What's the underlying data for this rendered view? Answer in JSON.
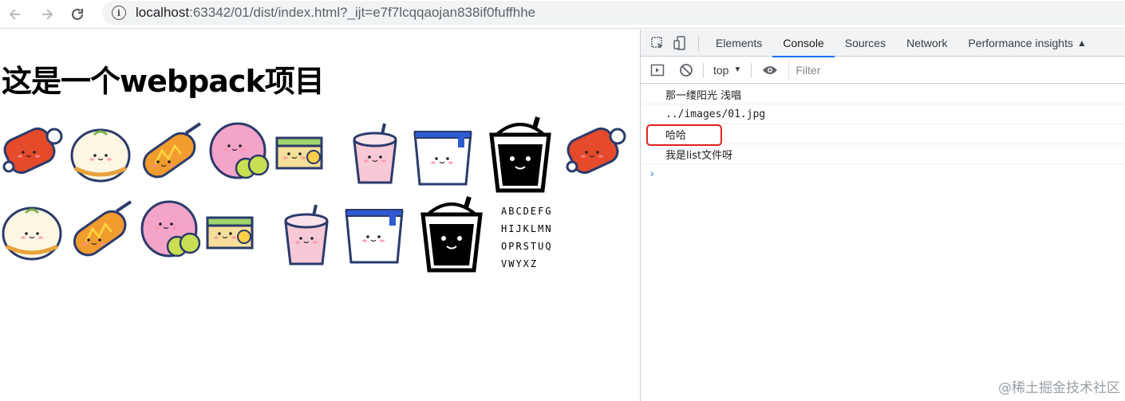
{
  "browser": {
    "url_host": "localhost",
    "url_rest": ":63342/01/dist/index.html?_ijt=e7f7lcqqaojan838if0fuffhhe"
  },
  "page": {
    "heading": "这是一个webpack项目",
    "font_sample": [
      "ABCDEFG",
      "HIJKLMN",
      "OPRSTUQ",
      "VWYXZ"
    ]
  },
  "devtools": {
    "tabs": [
      "Elements",
      "Console",
      "Sources",
      "Network",
      "Performance insights"
    ],
    "active_tab": "Console",
    "context": "top",
    "filter_placeholder": "Filter",
    "console_lines": [
      "那一缕阳光 浅唱",
      "../images/01.jpg",
      "哈哈",
      "我是list文件呀"
    ],
    "prompt": "›"
  },
  "watermark": "@稀土掘金技术社区",
  "colors": {
    "accent": "#1a73e8",
    "highlight": "#e0251c"
  }
}
